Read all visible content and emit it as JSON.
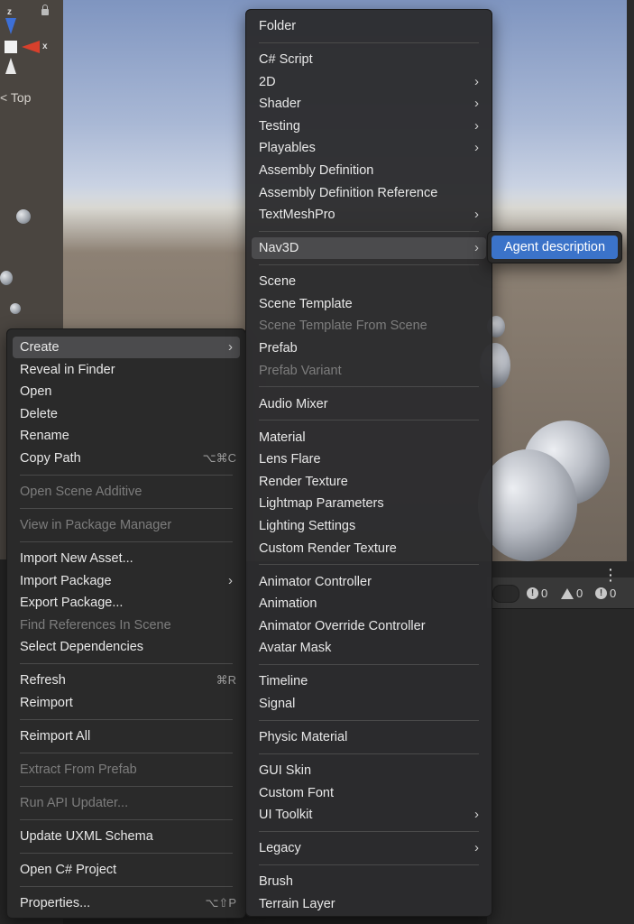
{
  "scene": {
    "gizmo": {
      "z_label": "z",
      "x_label": "x"
    },
    "view_label": "Top",
    "console_counts": {
      "errors": "0",
      "warnings": "0",
      "messages": "0"
    }
  },
  "asset_menu": {
    "items": [
      {
        "label": "Create",
        "submenu": true,
        "hover": true
      },
      {
        "label": "Reveal in Finder"
      },
      {
        "label": "Open"
      },
      {
        "label": "Delete"
      },
      {
        "label": "Rename"
      },
      {
        "label": "Copy Path",
        "shortcut": "⌥⌘C"
      },
      {
        "separator": true
      },
      {
        "label": "Open Scene Additive",
        "disabled": true
      },
      {
        "separator": true
      },
      {
        "label": "View in Package Manager",
        "disabled": true
      },
      {
        "separator": true
      },
      {
        "label": "Import New Asset..."
      },
      {
        "label": "Import Package",
        "submenu": true
      },
      {
        "label": "Export Package..."
      },
      {
        "label": "Find References In Scene",
        "disabled": true
      },
      {
        "label": "Select Dependencies"
      },
      {
        "separator": true
      },
      {
        "label": "Refresh",
        "shortcut": "⌘R"
      },
      {
        "label": "Reimport"
      },
      {
        "separator": true
      },
      {
        "label": "Reimport All"
      },
      {
        "separator": true
      },
      {
        "label": "Extract From Prefab",
        "disabled": true
      },
      {
        "separator": true
      },
      {
        "label": "Run API Updater...",
        "disabled": true
      },
      {
        "separator": true
      },
      {
        "label": "Update UXML Schema"
      },
      {
        "separator": true
      },
      {
        "label": "Open C# Project"
      },
      {
        "separator": true
      },
      {
        "label": "Properties...",
        "shortcut": "⌥⇧P"
      }
    ]
  },
  "create_menu": {
    "items": [
      {
        "label": "Folder"
      },
      {
        "separator": true
      },
      {
        "label": "C# Script"
      },
      {
        "label": "2D",
        "submenu": true
      },
      {
        "label": "Shader",
        "submenu": true
      },
      {
        "label": "Testing",
        "submenu": true
      },
      {
        "label": "Playables",
        "submenu": true
      },
      {
        "label": "Assembly Definition"
      },
      {
        "label": "Assembly Definition Reference"
      },
      {
        "label": "TextMeshPro",
        "submenu": true
      },
      {
        "separator": true
      },
      {
        "label": "Nav3D",
        "submenu": true,
        "hover": true
      },
      {
        "separator": true
      },
      {
        "label": "Scene"
      },
      {
        "label": "Scene Template"
      },
      {
        "label": "Scene Template From Scene",
        "disabled": true
      },
      {
        "label": "Prefab"
      },
      {
        "label": "Prefab Variant",
        "disabled": true
      },
      {
        "separator": true
      },
      {
        "label": "Audio Mixer"
      },
      {
        "separator": true
      },
      {
        "label": "Material"
      },
      {
        "label": "Lens Flare"
      },
      {
        "label": "Render Texture"
      },
      {
        "label": "Lightmap Parameters"
      },
      {
        "label": "Lighting Settings"
      },
      {
        "label": "Custom Render Texture"
      },
      {
        "separator": true
      },
      {
        "label": "Animator Controller"
      },
      {
        "label": "Animation"
      },
      {
        "label": "Animator Override Controller"
      },
      {
        "label": "Avatar Mask"
      },
      {
        "separator": true
      },
      {
        "label": "Timeline"
      },
      {
        "label": "Signal"
      },
      {
        "separator": true
      },
      {
        "label": "Physic Material"
      },
      {
        "separator": true
      },
      {
        "label": "GUI Skin"
      },
      {
        "label": "Custom Font"
      },
      {
        "label": "UI Toolkit",
        "submenu": true
      },
      {
        "separator": true
      },
      {
        "label": "Legacy",
        "submenu": true
      },
      {
        "separator": true
      },
      {
        "label": "Brush"
      },
      {
        "label": "Terrain Layer"
      }
    ]
  },
  "nav3d_submenu": {
    "items": [
      {
        "label": "Agent description",
        "selected": true
      }
    ]
  },
  "colors": {
    "menu_bg": "#2a2a2a",
    "hover": "#4b4b4d",
    "selected": "#3b73c9",
    "disabled_text": "#7d7d7d"
  }
}
